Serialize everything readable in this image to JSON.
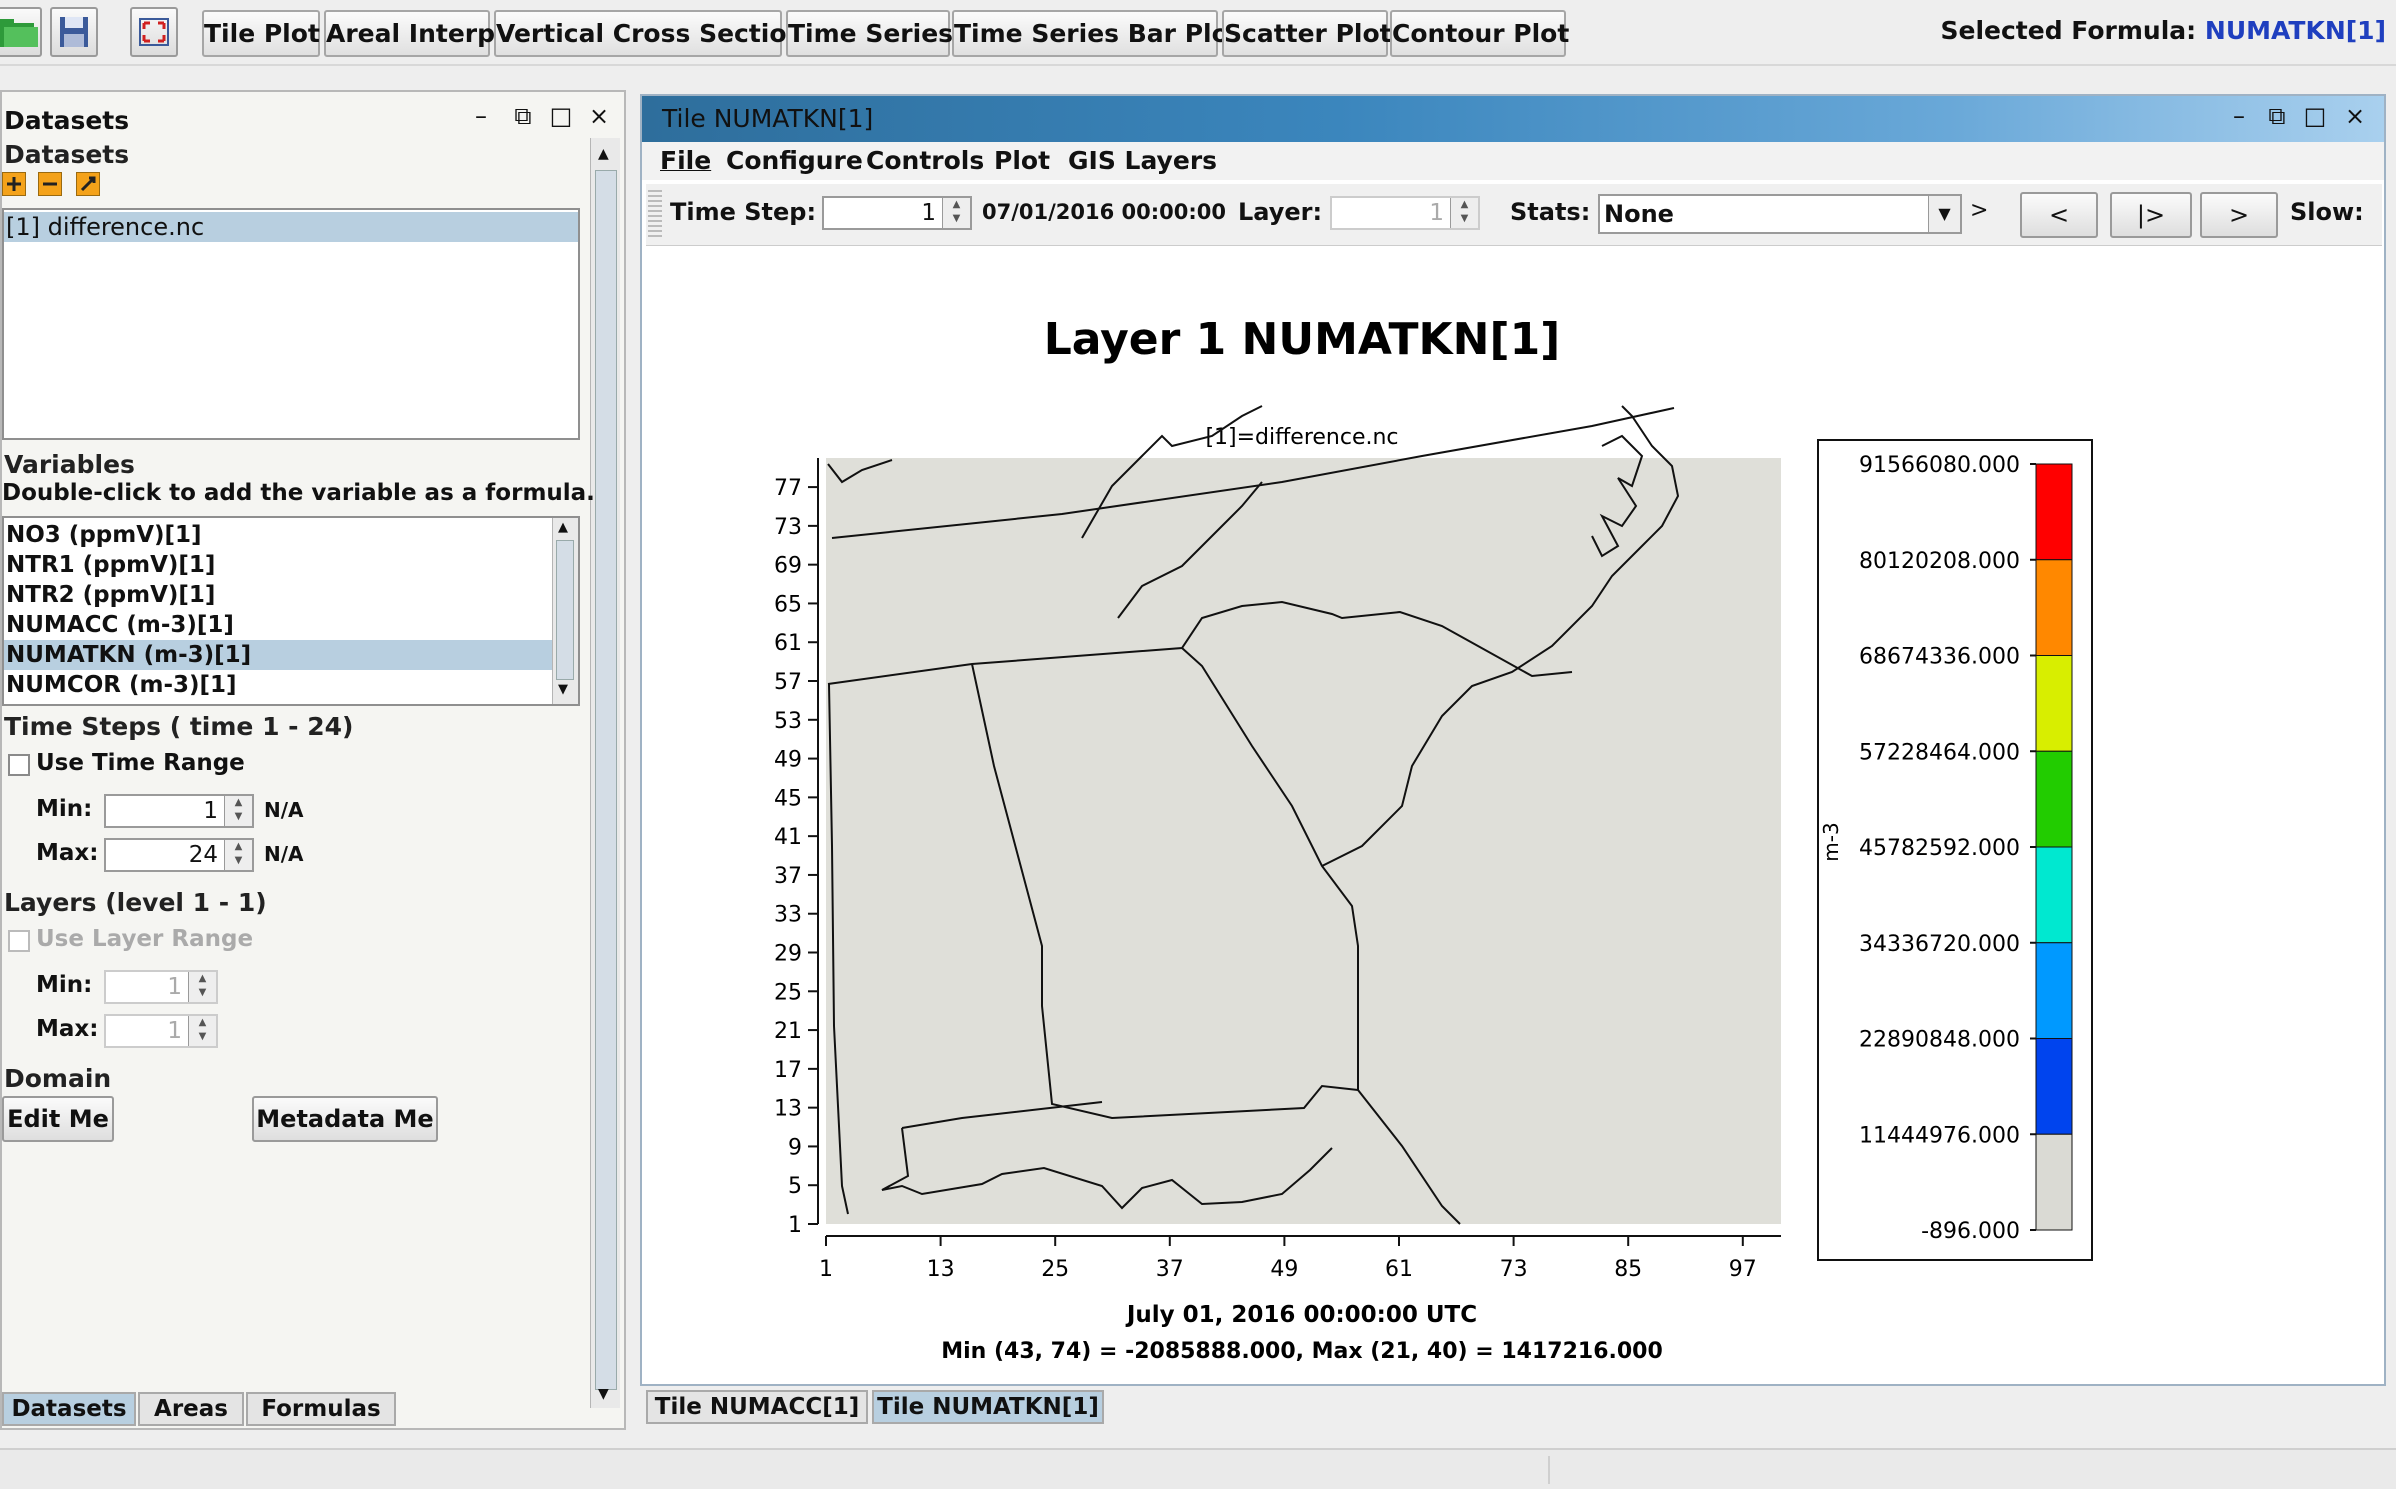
{
  "toolbar": {
    "buttons": [
      "Tile Plot",
      "Areal Interp",
      "Vertical Cross Section",
      "Time Series",
      "Time Series Bar Plot",
      "Scatter Plot",
      "Contour Plot"
    ],
    "selected_formula_label": "Selected Formula:",
    "selected_formula_value": "NUMATKN[1]",
    "icons": [
      "open-folder-icon",
      "save-icon",
      "fullscreen-icon"
    ]
  },
  "left_panel": {
    "title": "Datasets",
    "datasets_group": "Datasets",
    "datasets": [
      "[1] difference.nc"
    ],
    "variables_group": "Variables",
    "variables_hint": "Double-click to add the variable as a formula.",
    "variables": [
      "NO3 (ppmV)[1]",
      "NTR1 (ppmV)[1]",
      "NTR2 (ppmV)[1]",
      "NUMACC (m-3)[1]",
      "NUMATKN (m-3)[1]",
      "NUMCOR (m-3)[1]"
    ],
    "selected_variable_index": 4,
    "time_steps_group": "Time Steps ( time 1 - 24)",
    "use_time_range": "Use Time Range",
    "min_label": "Min:",
    "max_label": "Max:",
    "time_min": "1",
    "time_max": "24",
    "na": "N/A",
    "layers_group": "Layers (level 1 - 1)",
    "use_layer_range": "Use Layer Range",
    "layer_min": "1",
    "layer_max": "1",
    "domain_group": "Domain",
    "edit_btn": "Edit Me",
    "metadata_btn": "Metadata Me",
    "tabs": [
      "Datasets",
      "Areas",
      "Formulas"
    ]
  },
  "plot_window": {
    "title": "Tile NUMATKN[1]",
    "menus": [
      "File",
      "Configure",
      "Controls",
      "Plot",
      "GIS Layers"
    ],
    "time_step_label": "Time Step:",
    "time_step_value": "1",
    "time_step_date": "07/01/2016 00:00:00",
    "layer_label": "Layer:",
    "layer_value": "1",
    "stats_label": "Stats:",
    "stats_value": "None",
    "stats_arrow": ">",
    "nav_buttons": [
      "<",
      "|>",
      ">"
    ],
    "slow_label": "Slow:",
    "tabs": [
      "Tile NUMACC[1]",
      "Tile NUMATKN[1]"
    ]
  },
  "chart_data": {
    "type": "heatmap",
    "title": "Layer 1 NUMATKN[1]",
    "subtitle": "[1]=difference.nc",
    "xlabel": "",
    "ylabel": "",
    "x_ticks": [
      "1",
      "13",
      "25",
      "37",
      "49",
      "61",
      "73",
      "85",
      "97"
    ],
    "y_ticks": [
      "1",
      "5",
      "9",
      "13",
      "17",
      "21",
      "25",
      "29",
      "33",
      "37",
      "41",
      "45",
      "49",
      "53",
      "57",
      "61",
      "65",
      "69",
      "73",
      "77"
    ],
    "xlim": [
      1,
      101
    ],
    "ylim": [
      1,
      80
    ],
    "caption_time": "July 01, 2016 00:00:00 UTC",
    "caption_stats": "Min (43, 74) = -2085888.000, Max (21, 40) = 1417216.000",
    "legend_unit": "m-3",
    "legend_values": [
      "91566080.000",
      "80120208.000",
      "68674336.000",
      "57228464.000",
      "45782592.000",
      "34336720.000",
      "22890848.000",
      "11444976.000",
      "-896.000"
    ],
    "legend_colors": [
      "#ff0000",
      "#ff8800",
      "#d8ee00",
      "#22cc00",
      "#00e8d0",
      "#0099ff",
      "#0044ee",
      "#dadad4"
    ],
    "field_color": "#dfdfd9"
  }
}
